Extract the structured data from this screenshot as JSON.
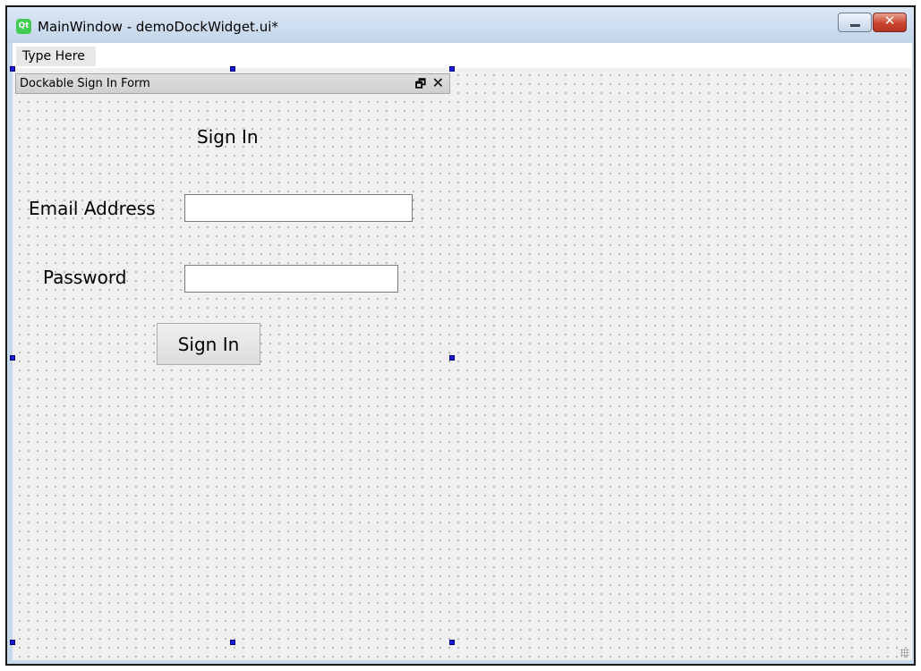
{
  "window": {
    "title": "MainWindow - demoDockWidget.ui*",
    "icon": "qt-logo-icon",
    "controls": {
      "minimize": "minimize-icon",
      "close_glyph": "✕"
    }
  },
  "menubar": {
    "placeholder_item": "Type Here"
  },
  "dock": {
    "title": "Dockable Sign In Form",
    "float_glyph": "🗗",
    "close_glyph": "✕"
  },
  "form": {
    "heading": "Sign In",
    "email_label": "Email Address",
    "email_value": "",
    "password_label": "Password",
    "password_value": "",
    "submit_label": "Sign In"
  },
  "colors": {
    "selection_handle": "#1a1ad6",
    "canvas_background": "#f0f0f0",
    "titlebar": "#c9d9ec"
  }
}
